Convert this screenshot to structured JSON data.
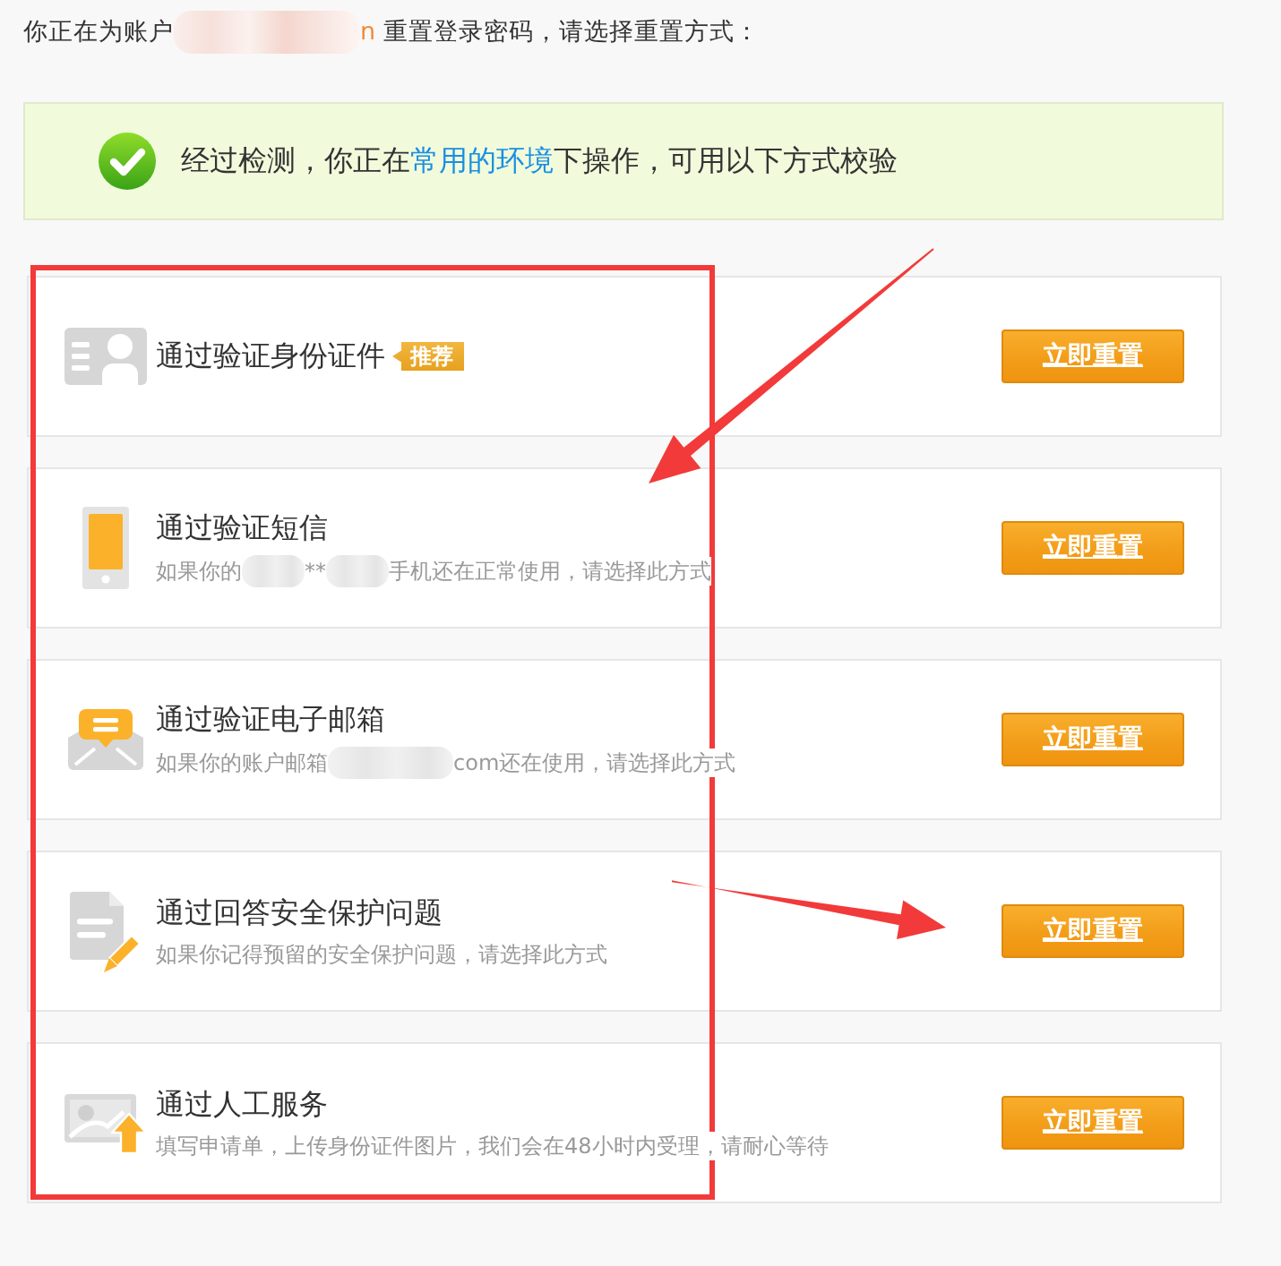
{
  "header": {
    "segments": [
      {
        "kind": "text",
        "text": "你正在为账户"
      },
      {
        "kind": "redacted"
      },
      {
        "kind": "accent",
        "text": "n"
      },
      {
        "kind": "text",
        "text": " 重置登录密码，请选择重置方式："
      }
    ]
  },
  "notice": {
    "segments": [
      {
        "kind": "text",
        "text": "经过检测，你正在"
      },
      {
        "kind": "link",
        "text": "常用的环境"
      },
      {
        "kind": "text",
        "text": "下操作，可用以下方式校验"
      }
    ]
  },
  "methods": [
    {
      "kind": "id_card",
      "title": "通过验证身份证件",
      "badge": "推荐",
      "button": "立即重置"
    },
    {
      "kind": "phone",
      "title": "通过验证短信",
      "description": [
        {
          "kind": "text",
          "text": "如果你的"
        },
        {
          "kind": "redacted"
        },
        {
          "kind": "text",
          "text": "**"
        },
        {
          "kind": "redacted"
        },
        {
          "kind": "text",
          "text": "手机还在正常使用，请选择此方式"
        }
      ],
      "button": "立即重置"
    },
    {
      "kind": "mail",
      "title": "通过验证电子邮箱",
      "description": [
        {
          "kind": "text",
          "text": "如果你的账户邮箱"
        },
        {
          "kind": "redacted"
        },
        {
          "kind": "text",
          "text": "com还在使用，请选择此方式"
        }
      ],
      "button": "立即重置"
    },
    {
      "kind": "document",
      "title": "通过回答安全保护问题",
      "description": [
        {
          "kind": "text",
          "text": "如果你记得预留的安全保护问题，请选择此方式"
        }
      ],
      "button": "立即重置"
    },
    {
      "kind": "photo_upload",
      "title": "通过人工服务",
      "description": [
        {
          "kind": "text",
          "text": "填写申请单，上传身份证件图片，我们会在48小时内受理，请耐心等待"
        }
      ],
      "button": "立即重置"
    }
  ],
  "annotations": [
    {
      "kind": "frame"
    },
    {
      "kind": "arrow"
    },
    {
      "kind": "arrow"
    }
  ]
}
